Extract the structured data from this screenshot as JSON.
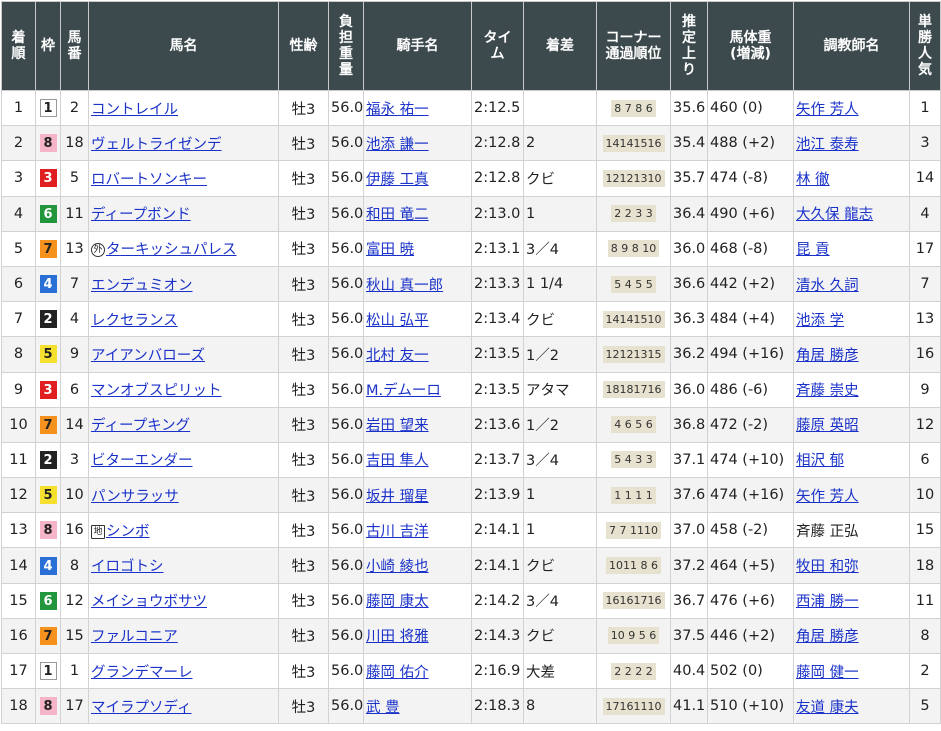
{
  "headers": {
    "rank": [
      "着",
      "順"
    ],
    "waku": [
      "枠"
    ],
    "umaban": [
      "馬",
      "番"
    ],
    "horse": [
      "馬名"
    ],
    "sexage": [
      "性齢"
    ],
    "weight": [
      "負",
      "担",
      "重",
      "量"
    ],
    "jockey": [
      "騎手名"
    ],
    "time": [
      "タイ",
      "ム"
    ],
    "margin": [
      "着差"
    ],
    "corner": [
      "コーナー",
      "通過順位"
    ],
    "last3f": [
      "推",
      "定",
      "上",
      "り"
    ],
    "bodyweight": [
      "馬体重",
      "(増減)"
    ],
    "trainer": [
      "調教師名"
    ],
    "pop": [
      "単",
      "勝",
      "人",
      "気"
    ]
  },
  "waku_colors": {
    "1": {
      "bg": "#ffffff",
      "fg": "#222222"
    },
    "2": {
      "bg": "#222222",
      "fg": "#ffffff"
    },
    "3": {
      "bg": "#e02020",
      "fg": "#ffffff"
    },
    "4": {
      "bg": "#2a6fd6",
      "fg": "#ffffff"
    },
    "5": {
      "bg": "#f5e030",
      "fg": "#222222"
    },
    "6": {
      "bg": "#22963c",
      "fg": "#ffffff"
    },
    "7": {
      "bg": "#f5921e",
      "fg": "#222222"
    },
    "8": {
      "bg": "#f6b4c8",
      "fg": "#222222"
    }
  },
  "rows": [
    {
      "rank": "1",
      "waku": "1",
      "umaban": "2",
      "prefix": "",
      "horse": "コントレイル",
      "sexage": "牡3",
      "weight": "56.0",
      "jockey": "福永 祐一",
      "time": "2:12.5",
      "margin": "",
      "corner": "8 7 8 6",
      "last3f": "35.6",
      "bodyweight": "460 (0)",
      "trainer": "矢作 芳人",
      "trainer_link": true,
      "pop": "1"
    },
    {
      "rank": "2",
      "waku": "8",
      "umaban": "18",
      "prefix": "",
      "horse": "ヴェルトライゼンデ",
      "sexage": "牡3",
      "weight": "56.0",
      "jockey": "池添 謙一",
      "time": "2:12.8",
      "margin": "2",
      "corner": "14141516",
      "last3f": "35.4",
      "bodyweight": "488 (+2)",
      "trainer": "池江 泰寿",
      "trainer_link": true,
      "pop": "3"
    },
    {
      "rank": "3",
      "waku": "3",
      "umaban": "5",
      "prefix": "",
      "horse": "ロバートソンキー",
      "sexage": "牡3",
      "weight": "56.0",
      "jockey": "伊藤 工真",
      "time": "2:12.8",
      "margin": "クビ",
      "corner": "12121310",
      "last3f": "35.7",
      "bodyweight": "474 (-8)",
      "trainer": "林 徹",
      "trainer_link": true,
      "pop": "14"
    },
    {
      "rank": "4",
      "waku": "6",
      "umaban": "11",
      "prefix": "",
      "horse": "ディープボンド",
      "sexage": "牡3",
      "weight": "56.0",
      "jockey": "和田 竜二",
      "time": "2:13.0",
      "margin": "1",
      "corner": "2 2 3 3",
      "last3f": "36.4",
      "bodyweight": "490 (+6)",
      "trainer": "大久保 龍志",
      "trainer_link": true,
      "pop": "4"
    },
    {
      "rank": "5",
      "waku": "7",
      "umaban": "13",
      "prefix": "外",
      "horse": "ターキッシュパレス",
      "sexage": "牡3",
      "weight": "56.0",
      "jockey": "富田 暁",
      "time": "2:13.1",
      "margin": "3／4",
      "corner": "8 9 8 10",
      "last3f": "36.0",
      "bodyweight": "468 (-8)",
      "trainer": "昆 貢",
      "trainer_link": true,
      "pop": "17"
    },
    {
      "rank": "6",
      "waku": "4",
      "umaban": "7",
      "prefix": "",
      "horse": "エンデュミオン",
      "sexage": "牡3",
      "weight": "56.0",
      "jockey": "秋山 真一郎",
      "time": "2:13.3",
      "margin": "1 1/4",
      "corner": "5 4 5 5",
      "last3f": "36.6",
      "bodyweight": "442 (+2)",
      "trainer": "清水 久詞",
      "trainer_link": true,
      "pop": "7"
    },
    {
      "rank": "7",
      "waku": "2",
      "umaban": "4",
      "prefix": "",
      "horse": "レクセランス",
      "sexage": "牡3",
      "weight": "56.0",
      "jockey": "松山 弘平",
      "time": "2:13.4",
      "margin": "クビ",
      "corner": "14141510",
      "last3f": "36.3",
      "bodyweight": "484 (+4)",
      "trainer": "池添 学",
      "trainer_link": true,
      "pop": "13"
    },
    {
      "rank": "8",
      "waku": "5",
      "umaban": "9",
      "prefix": "",
      "horse": "アイアンバローズ",
      "sexage": "牡3",
      "weight": "56.0",
      "jockey": "北村 友一",
      "time": "2:13.5",
      "margin": "1／2",
      "corner": "12121315",
      "last3f": "36.2",
      "bodyweight": "494 (+16)",
      "trainer": "角居 勝彦",
      "trainer_link": true,
      "pop": "16"
    },
    {
      "rank": "9",
      "waku": "3",
      "umaban": "6",
      "prefix": "",
      "horse": "マンオブスピリット",
      "sexage": "牡3",
      "weight": "56.0",
      "jockey": "M.デムーロ",
      "time": "2:13.5",
      "margin": "アタマ",
      "corner": "18181716",
      "last3f": "36.0",
      "bodyweight": "486 (-6)",
      "trainer": "斉藤 崇史",
      "trainer_link": true,
      "pop": "9"
    },
    {
      "rank": "10",
      "waku": "7",
      "umaban": "14",
      "prefix": "",
      "horse": "ディープキング",
      "sexage": "牡3",
      "weight": "56.0",
      "jockey": "岩田 望来",
      "time": "2:13.6",
      "margin": "1／2",
      "corner": "4 6 5 6",
      "last3f": "36.8",
      "bodyweight": "472 (-2)",
      "trainer": "藤原 英昭",
      "trainer_link": true,
      "pop": "12"
    },
    {
      "rank": "11",
      "waku": "2",
      "umaban": "3",
      "prefix": "",
      "horse": "ビターエンダー",
      "sexage": "牡3",
      "weight": "56.0",
      "jockey": "吉田 隼人",
      "time": "2:13.7",
      "margin": "3／4",
      "corner": "5 4 3 3",
      "last3f": "37.1",
      "bodyweight": "474 (+10)",
      "trainer": "相沢 郁",
      "trainer_link": true,
      "pop": "6"
    },
    {
      "rank": "12",
      "waku": "5",
      "umaban": "10",
      "prefix": "",
      "horse": "パンサラッサ",
      "sexage": "牡3",
      "weight": "56.0",
      "jockey": "坂井 瑠星",
      "time": "2:13.9",
      "margin": "1",
      "corner": "1 1 1 1",
      "last3f": "37.6",
      "bodyweight": "474 (+16)",
      "trainer": "矢作 芳人",
      "trainer_link": true,
      "pop": "10"
    },
    {
      "rank": "13",
      "waku": "8",
      "umaban": "16",
      "prefix": "地",
      "horse": "シンボ",
      "sexage": "牡3",
      "weight": "56.0",
      "jockey": "古川 吉洋",
      "time": "2:14.1",
      "margin": "1",
      "corner": "7 7 1110",
      "last3f": "37.0",
      "bodyweight": "458 (-2)",
      "trainer": "斉藤 正弘",
      "trainer_link": false,
      "pop": "15"
    },
    {
      "rank": "14",
      "waku": "4",
      "umaban": "8",
      "prefix": "",
      "horse": "イロゴトシ",
      "sexage": "牡3",
      "weight": "56.0",
      "jockey": "小崎 綾也",
      "time": "2:14.1",
      "margin": "クビ",
      "corner": "1011 8 6",
      "last3f": "37.2",
      "bodyweight": "464 (+5)",
      "trainer": "牧田 和弥",
      "trainer_link": true,
      "pop": "18"
    },
    {
      "rank": "15",
      "waku": "6",
      "umaban": "12",
      "prefix": "",
      "horse": "メイショウボサツ",
      "sexage": "牡3",
      "weight": "56.0",
      "jockey": "藤岡 康太",
      "time": "2:14.2",
      "margin": "3／4",
      "corner": "16161716",
      "last3f": "36.7",
      "bodyweight": "476 (+6)",
      "trainer": "西浦 勝一",
      "trainer_link": true,
      "pop": "11"
    },
    {
      "rank": "16",
      "waku": "7",
      "umaban": "15",
      "prefix": "",
      "horse": "ファルコニア",
      "sexage": "牡3",
      "weight": "56.0",
      "jockey": "川田 将雅",
      "time": "2:14.3",
      "margin": "クビ",
      "corner": "10 9 5 6",
      "last3f": "37.5",
      "bodyweight": "446 (+2)",
      "trainer": "角居 勝彦",
      "trainer_link": true,
      "pop": "8"
    },
    {
      "rank": "17",
      "waku": "1",
      "umaban": "1",
      "prefix": "",
      "horse": "グランデマーレ",
      "sexage": "牡3",
      "weight": "56.0",
      "jockey": "藤岡 佑介",
      "time": "2:16.9",
      "margin": "大差",
      "corner": "2 2 2 2",
      "last3f": "40.4",
      "bodyweight": "502 (0)",
      "trainer": "藤岡 健一",
      "trainer_link": true,
      "pop": "2"
    },
    {
      "rank": "18",
      "waku": "8",
      "umaban": "17",
      "prefix": "",
      "horse": "マイラプソディ",
      "sexage": "牡3",
      "weight": "56.0",
      "jockey": "武 豊",
      "time": "2:18.3",
      "margin": "8",
      "corner": "17161110",
      "last3f": "41.1",
      "bodyweight": "510 (+10)",
      "trainer": "友道 康夫",
      "trainer_link": true,
      "pop": "5"
    }
  ]
}
